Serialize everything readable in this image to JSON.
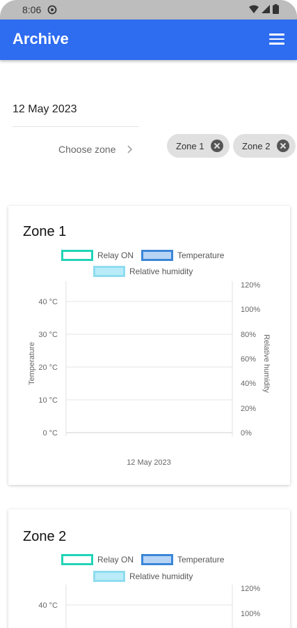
{
  "status_bar": {
    "time": "8:06"
  },
  "app_bar": {
    "title": "Archive",
    "menu_icon": "hamburger-menu-icon"
  },
  "filters": {
    "date": "12 May 2023",
    "choose_zone_label": "Choose zone",
    "chips": [
      {
        "label": "Zone 1"
      },
      {
        "label": "Zone 2"
      }
    ]
  },
  "colors": {
    "app_bar": "#2e6cf0",
    "relay_on_border": "#22d3b8",
    "temperature_fill": "#b8d4f5",
    "temperature_border": "#3b86d8",
    "humidity_fill": "#b9ecf8",
    "humidity_border": "#8fdcf0"
  },
  "legend": {
    "relay_on": "Relay ON",
    "temperature": "Temperature",
    "humidity": "Relative humidity"
  },
  "cards": [
    {
      "title": "Zone 1"
    },
    {
      "title": "Zone 2"
    }
  ],
  "chart_data": [
    {
      "type": "line",
      "title": "Zone 1",
      "series": [
        {
          "name": "Relay ON",
          "values": []
        },
        {
          "name": "Temperature",
          "values": []
        },
        {
          "name": "Relative humidity",
          "values": []
        }
      ],
      "y_left": {
        "label": "Temperature",
        "ticks": [
          "0 °C",
          "10 °C",
          "20 °C",
          "30 °C",
          "40 °C"
        ],
        "range": [
          0,
          45
        ]
      },
      "y_right": {
        "label": "Relative humidity",
        "ticks": [
          "0%",
          "20%",
          "40%",
          "60%",
          "80%",
          "100%",
          "120%"
        ],
        "range": [
          0,
          120
        ]
      },
      "x_label": "12 May 2023",
      "grid": true
    },
    {
      "type": "line",
      "title": "Zone 2",
      "series": [
        {
          "name": "Relay ON",
          "values": []
        },
        {
          "name": "Temperature",
          "values": []
        },
        {
          "name": "Relative humidity",
          "values": []
        }
      ],
      "y_left": {
        "ticks": [
          "40 °C"
        ]
      },
      "y_right": {
        "ticks": [
          "100%",
          "120%"
        ]
      },
      "grid": true
    }
  ]
}
